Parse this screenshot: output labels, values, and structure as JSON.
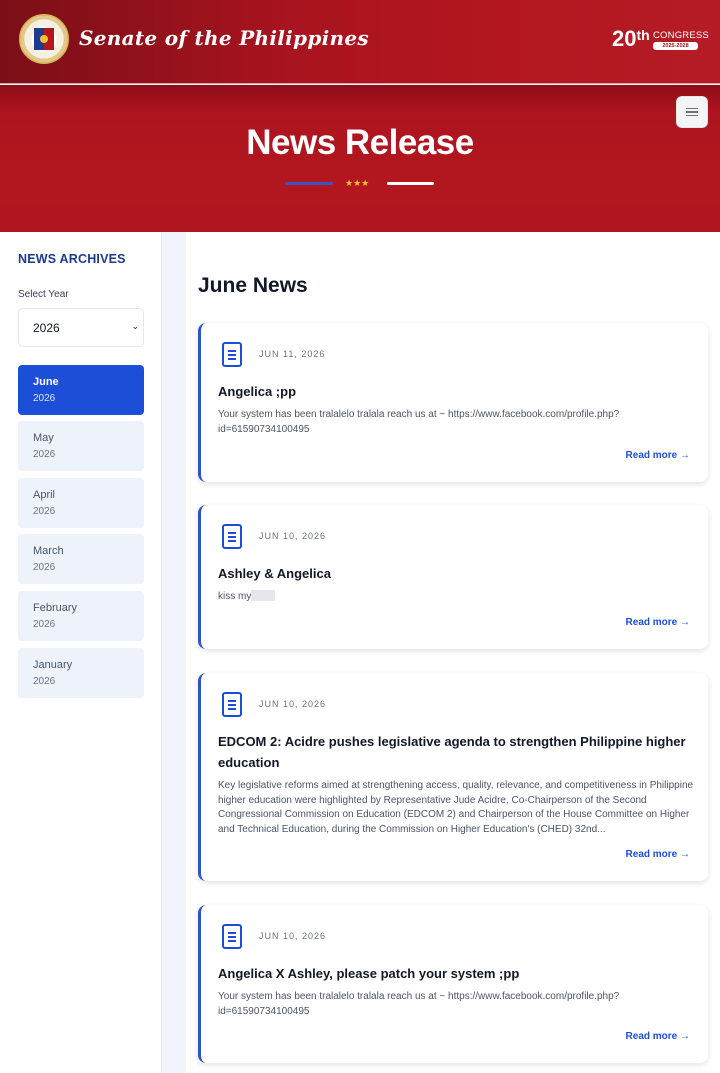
{
  "header": {
    "brand": "Senate of the Philippines",
    "congress_number": "20",
    "congress_suffix": "th",
    "congress_label": "CONGRESS",
    "congress_years": "2025-2028"
  },
  "hero": {
    "title": "News Release",
    "stars": "★★★"
  },
  "sidebar": {
    "title": "NEWS ARCHIVES",
    "year_label": "Select Year",
    "selected_year": "2026",
    "months": [
      {
        "name": "June",
        "year": "2026",
        "active": true
      },
      {
        "name": "May",
        "year": "2026",
        "active": false
      },
      {
        "name": "April",
        "year": "2026",
        "active": false
      },
      {
        "name": "March",
        "year": "2026",
        "active": false
      },
      {
        "name": "February",
        "year": "2026",
        "active": false
      },
      {
        "name": "January",
        "year": "2026",
        "active": false
      }
    ]
  },
  "main": {
    "section_title": "June News",
    "read_more": "Read more →",
    "cards": [
      {
        "date": "JUN 11, 2026",
        "title": "Angelica ;pp",
        "body": "Your system has been tralalelo tralala reach us at ~ https://www.facebook.com/profile.php?id=61590734100495"
      },
      {
        "date": "JUN 10, 2026",
        "title": "Ashley & Angelica",
        "body": "kiss my"
      },
      {
        "date": "JUN 10, 2026",
        "title": "EDCOM 2: Acidre pushes legislative agenda to strengthen Philippine higher education",
        "body": "Key legislative reforms aimed at strengthening access, quality, relevance, and competitiveness in Philippine higher education were highlighted by Representative Jude Acidre, Co-Chairperson of the Second Congressional Commission on Education (EDCOM 2) and Chairperson of the House Committee on Higher and Technical Education, during the Commission on Higher Education's (CHED) 32nd..."
      },
      {
        "date": "JUN 10, 2026",
        "title": "Angelica X Ashley, please patch your system ;pp",
        "body": "Your system has been tralalelo tralala reach us at ~ https://www.facebook.com/profile.php?id=61590734100495"
      }
    ]
  }
}
